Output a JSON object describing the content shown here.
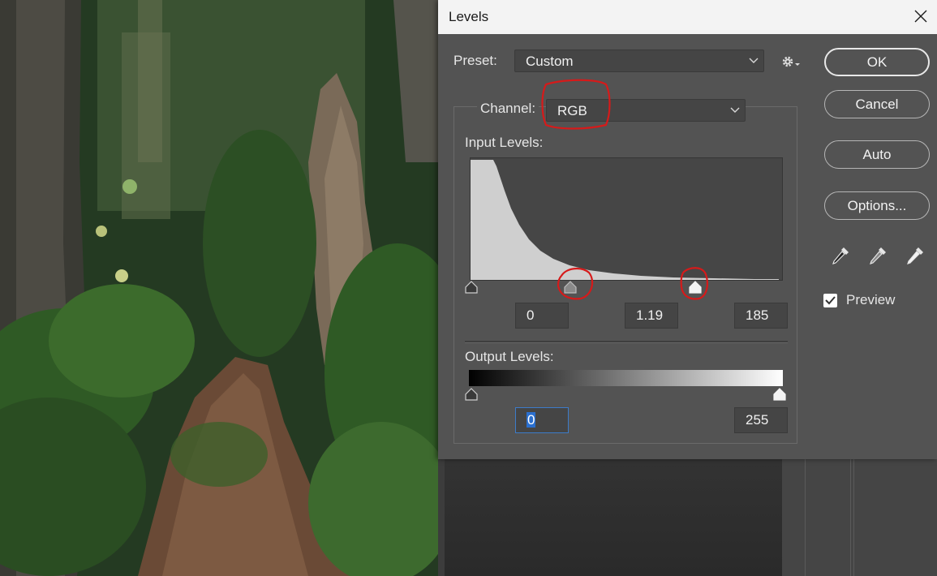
{
  "dialog": {
    "title": "Levels",
    "preset_label": "Preset:",
    "preset_value": "Custom",
    "channel_label": "Channel:",
    "channel_value": "RGB",
    "input_levels_label": "Input Levels:",
    "input_black": "0",
    "input_gamma": "1.19",
    "input_white": "185",
    "output_levels_label": "Output Levels:",
    "output_black": "0",
    "output_white": "255",
    "preview_label": "Preview",
    "preview_checked": true
  },
  "buttons": {
    "ok": "OK",
    "cancel": "Cancel",
    "auto": "Auto",
    "options": "Options..."
  },
  "icons": {
    "close": "close-icon",
    "gear": "gear-icon",
    "eyedroppers": [
      "black-point-eyedropper-icon",
      "gray-point-eyedropper-icon",
      "white-point-eyedropper-icon"
    ]
  },
  "colors": {
    "dialog_bg": "#535353",
    "field_bg": "#454545",
    "annotation_red": "#d61a1a",
    "selection_blue": "#2a6fcf"
  }
}
